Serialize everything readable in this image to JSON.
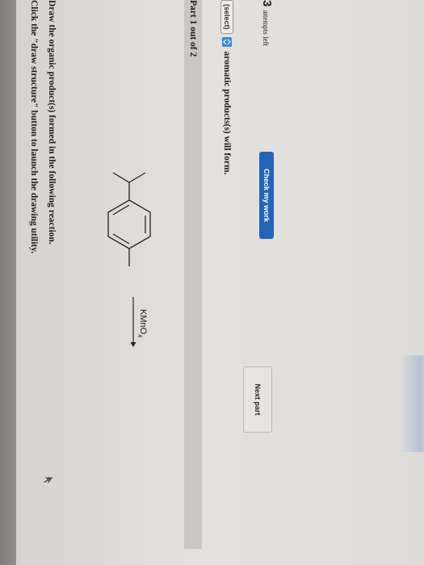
{
  "instructions": {
    "line1": "Click the \"draw structure\" button to launch the drawing utility.",
    "line2": "Draw the organic product(s) formed in the following reaction."
  },
  "reaction": {
    "reagent": "KMnO",
    "reagent_subscript": "4"
  },
  "part": {
    "label": "Part 1 out of 2"
  },
  "question": {
    "select_value": "(select)",
    "suffix": "aromatic products(s) will form."
  },
  "attempts": {
    "count": "3",
    "label": "attempts left"
  },
  "buttons": {
    "check": "Check my work",
    "next": "Next part"
  },
  "colors": {
    "accent": "#2165b8",
    "select_accent": "#3c88d8"
  }
}
